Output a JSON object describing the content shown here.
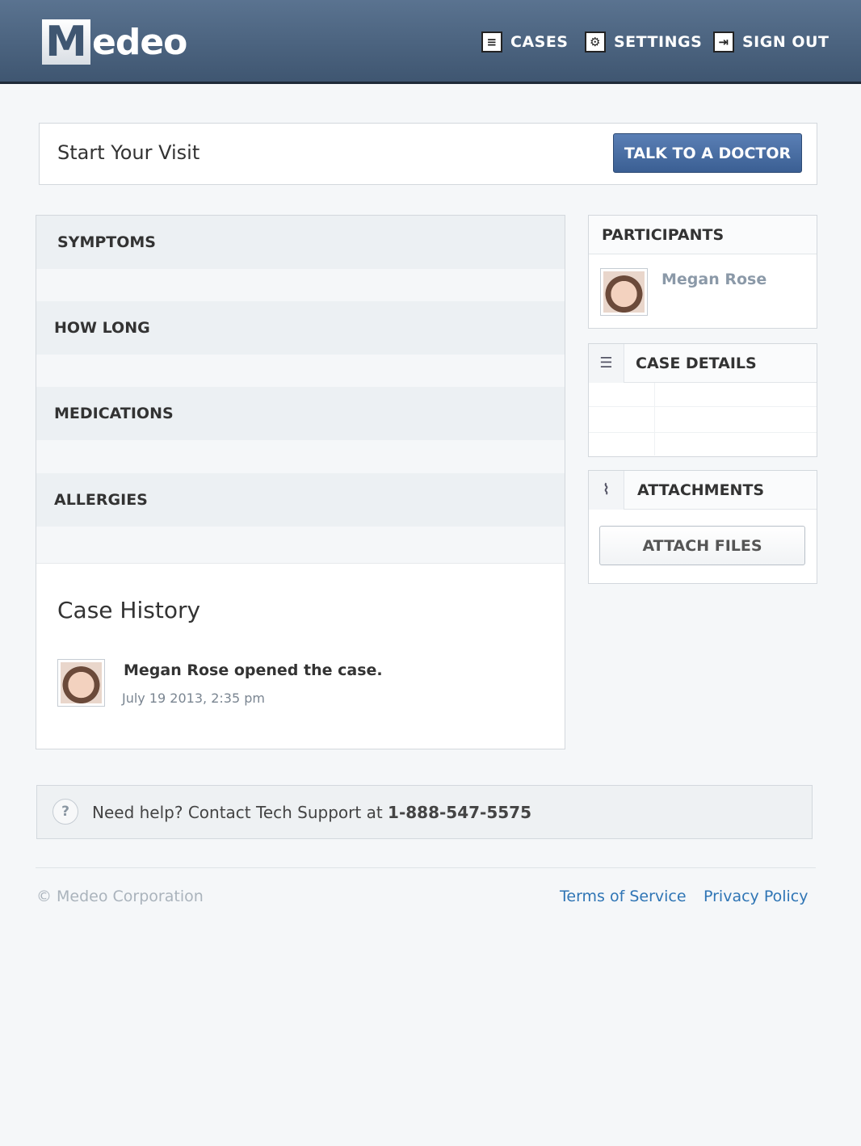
{
  "header": {
    "logo_initial": "M",
    "logo_rest": "edeo",
    "nav": [
      {
        "label": "CASES",
        "icon": "document-icon"
      },
      {
        "label": "SETTINGS",
        "icon": "gear-icon"
      },
      {
        "label": "SIGN OUT",
        "icon": "sign-out-icon"
      }
    ]
  },
  "start_visit": {
    "title": "Start Your Visit",
    "button_label": "TALK TO A DOCTOR"
  },
  "sections": [
    {
      "label": "SYMPTOMS"
    },
    {
      "label": "HOW LONG"
    },
    {
      "label": "MEDICATIONS"
    },
    {
      "label": "ALLERGIES"
    }
  ],
  "case_history": {
    "title": "Case History",
    "entries": [
      {
        "text": "Megan Rose opened the case.",
        "time": "July 19 2013, 2:35 pm"
      }
    ]
  },
  "participants": {
    "title": "PARTICIPANTS",
    "people": [
      {
        "name": "Megan Rose"
      }
    ]
  },
  "case_details": {
    "title": "CASE DETAILS",
    "icon": "list-icon"
  },
  "attachments": {
    "title": "ATTACHMENTS",
    "icon": "paperclip-icon",
    "button_label": "ATTACH FILES"
  },
  "help": {
    "icon": "?",
    "text": "Need help? Contact Tech Support at ",
    "phone": "1-888-547-5575"
  },
  "footer": {
    "copyright": "© Medeo Corporation",
    "links": [
      "Terms of Service",
      "Privacy Policy"
    ]
  },
  "colors": {
    "header": "#4a627f",
    "accent_button": "#4a6fa5",
    "link": "#2f75b5"
  }
}
